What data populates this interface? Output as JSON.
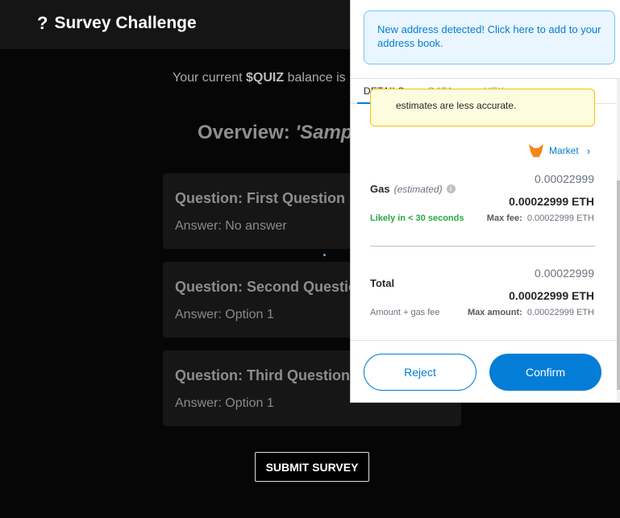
{
  "app": {
    "title": "Survey Challenge",
    "balance_prefix": "Your current ",
    "balance_token": "$QUIZ",
    "balance_suffix": " balance is",
    "overview_label": "Overview: ",
    "overview_name": "'Sampl",
    "questions": [
      {
        "question": "Question: First Question",
        "answer": "Answer: No answer"
      },
      {
        "question": "Question: Second Question",
        "answer": "Answer: Option 1"
      },
      {
        "question": "Question: Third Question",
        "answer": "Answer: Option 1"
      }
    ],
    "submit_label": "SUBMIT SURVEY"
  },
  "wallet": {
    "notice": "New address detected! Click here to add to your address book.",
    "tabs": [
      "DETAILS",
      "DATA",
      "HEX"
    ],
    "warning_text": "estimates are less accurate.",
    "market_label": "Market",
    "gas_label": "Gas",
    "gas_estimated": "(estimated)",
    "gas_amount": "0.00022999",
    "gas_amount_eth": "0.00022999 ETH",
    "likely_text": "Likely in < 30 seconds",
    "max_fee_label": "Max fee:",
    "max_fee_value": "0.00022999 ETH",
    "total_label": "Total",
    "total_amount": "0.00022999",
    "total_amount_eth": "0.00022999 ETH",
    "amount_gas_label": "Amount + gas fee",
    "max_amount_label": "Max amount:",
    "max_amount_value": "0.00022999 ETH",
    "reject_label": "Reject",
    "confirm_label": "Confirm",
    "accent_color": "#037dd6"
  }
}
